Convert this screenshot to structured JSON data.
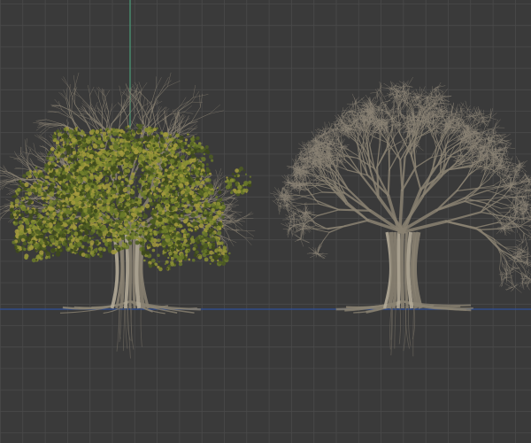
{
  "viewport": {
    "background": "#3a3a3a",
    "grid_color": "#4a4a4a",
    "axis_x_color": "#2f4f9a",
    "axis_z_color": "#4a9a78"
  },
  "objects": [
    {
      "name": "tree-with-leaves",
      "leaf_colors": [
        "#4f5e22",
        "#6b7a2a",
        "#8a8f34",
        "#a39a3e",
        "#3e4a1c"
      ],
      "trunk_color": "#8a8272"
    },
    {
      "name": "tree-bare-branches",
      "branch_color": "#8c8476",
      "trunk_color": "#8a8272"
    }
  ]
}
